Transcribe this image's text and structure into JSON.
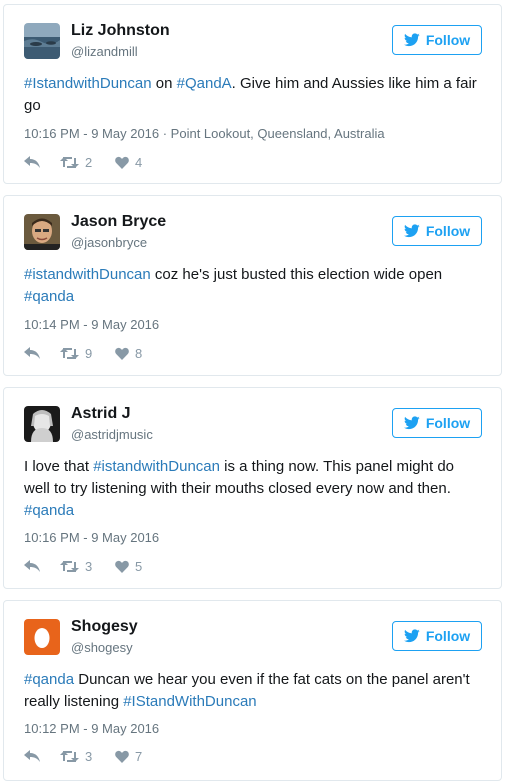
{
  "follow_label": "Follow",
  "tweets": [
    {
      "name": "Liz Johnston",
      "handle": "@lizandmill",
      "text_parts": [
        "#IstandwithDuncan",
        " on ",
        "#QandA",
        ". Give him and Aussies like him a fair go"
      ],
      "timestamp": "10:16 PM - 9 May 2016 · Point Lookout, Queensland, Australia",
      "retweets": "2",
      "likes": "4"
    },
    {
      "name": "Jason Bryce",
      "handle": "@jasonbryce",
      "text_parts": [
        "#istandwithDuncan",
        " coz he's just busted this election wide open ",
        "#qanda"
      ],
      "timestamp": "10:14 PM - 9 May 2016",
      "retweets": "9",
      "likes": "8"
    },
    {
      "name": "Astrid J",
      "handle": "@astridjmusic",
      "text_parts": [
        "I love that ",
        "#istandwithDuncan",
        " is a thing now. This panel might do well to try listening with their mouths closed every now and then. ",
        "#qanda"
      ],
      "timestamp": "10:16 PM - 9 May 2016",
      "retweets": "3",
      "likes": "5"
    },
    {
      "name": "Shogesy",
      "handle": "@shogesy",
      "text_parts": [
        "#qanda",
        " Duncan we hear you even if the fat cats on the panel aren't really listening ",
        "#IStandWithDuncan"
      ],
      "timestamp": "10:12 PM - 9 May 2016",
      "retweets": "3",
      "likes": "7"
    }
  ],
  "colors": {
    "link": "#2b7bb9",
    "twitter_blue": "#1da1f2",
    "meta": "#66757f",
    "action": "#8899a6",
    "border": "#e1e8ed",
    "egg_avatar": "#e8641b"
  }
}
